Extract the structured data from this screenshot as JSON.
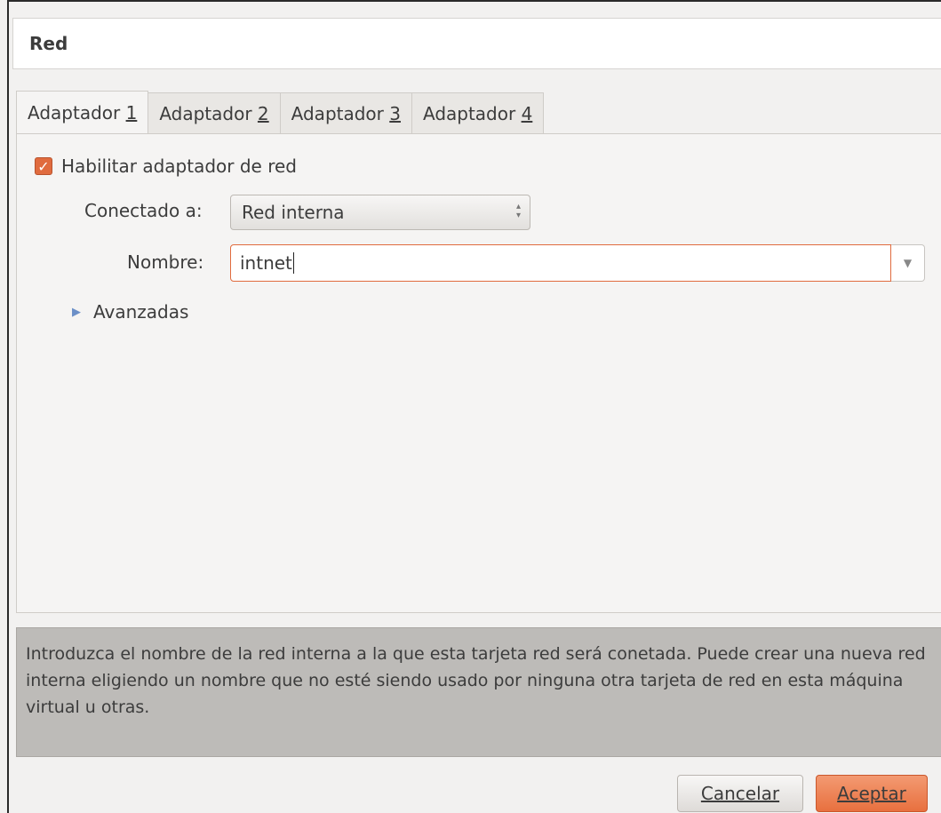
{
  "dialog": {
    "title": "Red"
  },
  "tabs": [
    {
      "label": "Adaptador",
      "num": "1"
    },
    {
      "label": "Adaptador",
      "num": "2"
    },
    {
      "label": "Adaptador",
      "num": "3"
    },
    {
      "label": "Adaptador",
      "num": "4"
    }
  ],
  "enable": {
    "checked": true,
    "label": "Habilitar adaptador de red"
  },
  "connected": {
    "label": "Conectado a:",
    "value": "Red interna"
  },
  "name": {
    "label": "Nombre:",
    "value": "intnet"
  },
  "advanced": {
    "label": "Avanzadas"
  },
  "info": {
    "text": "Introduzca el nombre de la red interna a la que esta tarjeta red será conetada. Puede crear una nueva red interna eligiendo un nombre que no esté siendo usado por ninguna otra tarjeta de red en esta máquina virtual u otras."
  },
  "buttons": {
    "cancel": "Cancelar",
    "ok": "Aceptar"
  },
  "colors": {
    "accent": "#e06b3e",
    "info_bg": "#bdbbb8"
  },
  "icons": {
    "checkbox": "checkmark-icon",
    "spin": "updown-arrows-icon",
    "dropdown": "chevron-down-icon",
    "expander": "triangle-right-icon"
  }
}
